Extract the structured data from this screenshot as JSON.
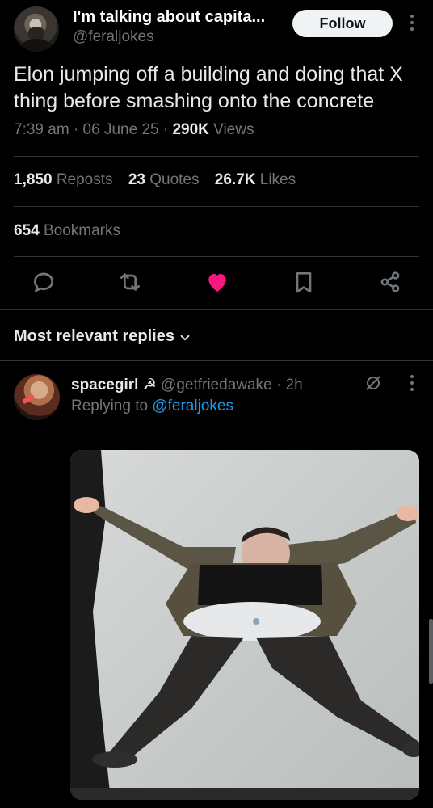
{
  "tweet": {
    "display_name": "I'm talking about capita...",
    "handle": "@feraljokes",
    "follow_label": "Follow",
    "text": "Elon jumping off a building and doing that X thing before smashing onto the concrete",
    "time": "7:39 am",
    "date": "06 June 25",
    "views_count": "290K",
    "views_label": "Views",
    "separator": "·"
  },
  "stats": {
    "reposts_count": "1,850",
    "reposts_label": "Reposts",
    "quotes_count": "23",
    "quotes_label": "Quotes",
    "likes_count": "26.7K",
    "likes_label": "Likes",
    "bookmarks_count": "654",
    "bookmarks_label": "Bookmarks"
  },
  "actions": {
    "icons": [
      "reply-icon",
      "repost-icon",
      "like-icon",
      "bookmark-icon",
      "share-icon"
    ],
    "like_color": "#f91880",
    "icon_color": "#71767b"
  },
  "replies": {
    "sort_label": "Most relevant replies",
    "items": [
      {
        "name": "spacegirl ☭",
        "handle": "@getfriedawake",
        "time": "2h",
        "replying_to_label": "Replying to",
        "replying_to_handle": "@feraljokes"
      }
    ]
  },
  "colors": {
    "background": "#000000",
    "text_primary": "#e7e9ea",
    "text_secondary": "#71767b",
    "link": "#1d9bf0",
    "divider": "#2f3336"
  }
}
